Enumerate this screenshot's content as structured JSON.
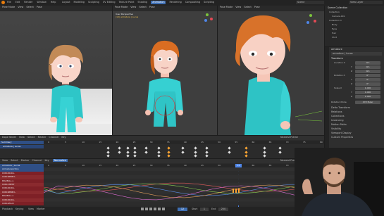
{
  "topbar": {
    "menus": [
      "File",
      "Edit",
      "Render",
      "Window",
      "Help"
    ],
    "workspace_tabs": [
      "Layout",
      "Modeling",
      "Sculpting",
      "UV Editing",
      "Texture Paint",
      "Shading",
      "Animation",
      "Rendering",
      "Compositing",
      "Scripting"
    ],
    "active_tab": "Animation",
    "scene": "Scene",
    "view_layer": "View Layer"
  },
  "viewport_left": {
    "mode": "Pose Mode",
    "menus": [
      "View",
      "Select",
      "Pose"
    ]
  },
  "viewport_center": {
    "mode": "Pose Mode",
    "menus": [
      "View",
      "Select",
      "Pose"
    ],
    "overlay_title": "User Perspective",
    "overlay_sub": "(12) armature | Lucas"
  },
  "viewport_right": {
    "mode": "Pose Mode",
    "menus": [
      "View",
      "Select",
      "Pose"
    ]
  },
  "outliner": {
    "header": "Scene Collection",
    "rows": [
      "Collection",
      "Camera.001",
      "Collection 3",
      "Body",
      "Eyes",
      "Hair",
      "Shirt"
    ]
  },
  "properties": {
    "object": "armature",
    "bone": "armature | Lucas",
    "section": "Transform",
    "rows": [
      {
        "label": "Location X",
        "value": "0m"
      },
      {
        "label": "Y",
        "value": "0m"
      },
      {
        "label": "Z",
        "value": "0m"
      },
      {
        "label": "Rotation X",
        "value": "0°"
      },
      {
        "label": "Y",
        "value": "0°"
      },
      {
        "label": "Z",
        "value": "0°"
      },
      {
        "label": "Scale X",
        "value": "1.000"
      },
      {
        "label": "Y",
        "value": "1.000"
      },
      {
        "label": "Z",
        "value": "1.000"
      }
    ],
    "mode_label": "Rotation Mode",
    "mode_value": "XYZ Euler",
    "panels": [
      "Delta Transform",
      "Relations",
      "Collections",
      "Instancing",
      "Motion Paths",
      "Visibility",
      "Viewport Display",
      "Custom Properties"
    ]
  },
  "dopesheet": {
    "mode": "Dope Sheet",
    "menus": [
      "View",
      "Select",
      "Marker",
      "Channel",
      "Key"
    ],
    "filter": "Nearest Frame",
    "channels": [
      "Summary",
      "armature | Lucas"
    ],
    "ruler": [
      "0",
      "5",
      "10",
      "15",
      "20",
      "25",
      "30",
      "35",
      "40",
      "45",
      "50",
      "55",
      "60",
      "65",
      "70",
      "75",
      "80"
    ]
  },
  "grapheditor": {
    "menus": [
      "View",
      "Select",
      "Marker",
      "Channel",
      "Key"
    ],
    "mode": "Normalize",
    "filter": "Nearest Frame",
    "channels": [
      "armature | Lucas",
      "ArmatureAction",
      "CON.RO.R.L",
      "CON.SPINE.L",
      "RIG.BALL.L",
      "CON.CHEST",
      "CON.RO.R.L",
      "CON.SPINE.L",
      "RIG.BALL.L",
      "CON.RO.R.L",
      "CON.LEG.R"
    ],
    "current_frame": "12"
  },
  "footer": {
    "left": [
      "Playback",
      "Keying",
      "View",
      "Marker"
    ],
    "frame": "12",
    "start_label": "Start",
    "start": "1",
    "end_label": "End",
    "end": "250",
    "status": "2.90.1"
  },
  "colors": {
    "accent": "#3f6fb3",
    "selected_key": "#ffa733",
    "channel_red": "#7e2026",
    "channel_blue": "#2f4f86"
  }
}
